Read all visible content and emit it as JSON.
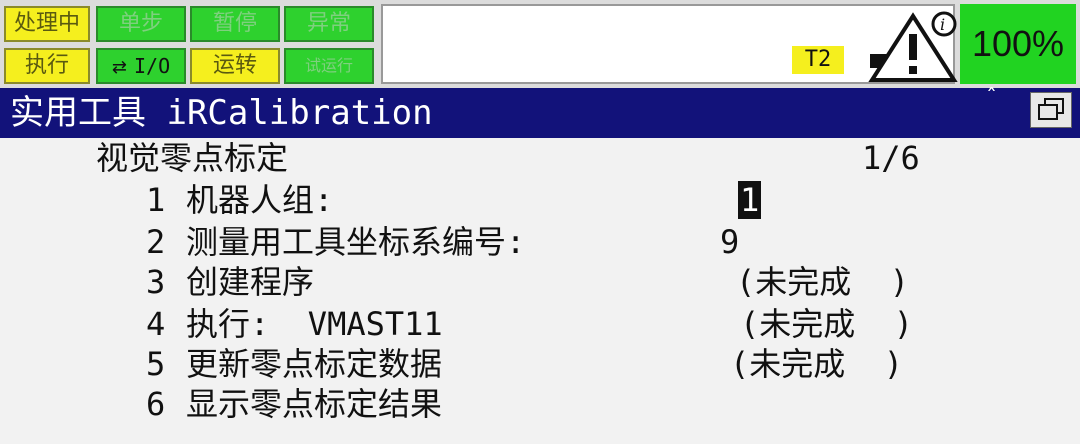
{
  "status_bar": {
    "processing": "处理中",
    "step": "单步",
    "hold": "暂停",
    "fault": "异常",
    "execute": "执行",
    "io": "I/O",
    "run": "运转",
    "gunout": "试运行",
    "mode": "T2",
    "override": "100%"
  },
  "window": {
    "title": "实用工具 iRCalibration"
  },
  "screen": {
    "heading": "视觉零点标定",
    "page": "1/6",
    "items": [
      {
        "num": "1",
        "label": "机器人组:",
        "value": "1"
      },
      {
        "num": "2",
        "label": "测量用工具坐标系编号:",
        "value": "9"
      },
      {
        "num": "3",
        "label": "创建程序",
        "status": "(未完成  )"
      },
      {
        "num": "4",
        "label": "执行:  VMAST11",
        "status": "(未完成  )"
      },
      {
        "num": "5",
        "label": "更新零点标定数据",
        "status": "(未完成  )"
      },
      {
        "num": "6",
        "label": "显示零点标定结果"
      }
    ]
  },
  "colors": {
    "yellow": "#f5ef1e",
    "green": "#2ed12e",
    "title_bg": "#12127a"
  }
}
